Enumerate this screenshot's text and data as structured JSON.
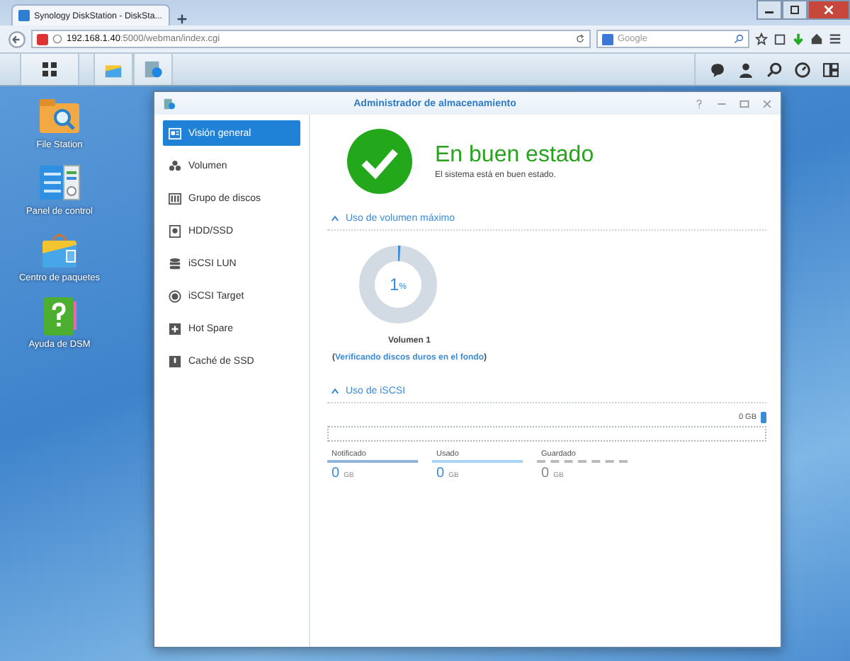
{
  "browser": {
    "tab_title": "Synology DiskStation - DiskSta...",
    "url_host": "192.168.1.40",
    "url_path": ":5000/webman/index.cgi",
    "search_placeholder": "Google"
  },
  "desktop_icons": [
    {
      "label": "File Station",
      "kind": "folder"
    },
    {
      "label": "Panel de control",
      "kind": "panel"
    },
    {
      "label": "Centro de paquetes",
      "kind": "bag"
    },
    {
      "label": "Ayuda de DSM",
      "kind": "help"
    }
  ],
  "window": {
    "title": "Administrador de almacenamiento"
  },
  "sidebar": {
    "items": [
      {
        "label": "Visión general",
        "kind": "overview",
        "selected": true
      },
      {
        "label": "Volumen",
        "kind": "volume",
        "selected": false
      },
      {
        "label": "Grupo de discos",
        "kind": "group",
        "selected": false
      },
      {
        "label": "HDD/SSD",
        "kind": "disk",
        "selected": false
      },
      {
        "label": "iSCSI LUN",
        "kind": "lun",
        "selected": false
      },
      {
        "label": "iSCSI Target",
        "kind": "target",
        "selected": false
      },
      {
        "label": "Hot Spare",
        "kind": "spare",
        "selected": false
      },
      {
        "label": "Caché de SSD",
        "kind": "cache",
        "selected": false
      }
    ]
  },
  "status": {
    "title": "En buen estado",
    "message": "El sistema está en buen estado."
  },
  "volume_usage": {
    "heading": "Uso de volumen máximo",
    "expanded": true,
    "percent": "1",
    "unit": "%",
    "level": 0.01,
    "caption_prefix": "Volumen 1 (",
    "link": "Verificando discos duros en el fondo",
    "caption_suffix": ")"
  },
  "iscsi_usage": {
    "heading": "Uso de iSCSI",
    "expanded": true,
    "bar_label": "0 GB",
    "stats": [
      {
        "label": "Notificado",
        "value": "0",
        "unit": "GB",
        "kind": "solid"
      },
      {
        "label": "Usado",
        "value": "0",
        "unit": "GB",
        "kind": "light"
      },
      {
        "label": "Guardado",
        "value": "0",
        "unit": "GB",
        "kind": "dashed"
      }
    ]
  }
}
